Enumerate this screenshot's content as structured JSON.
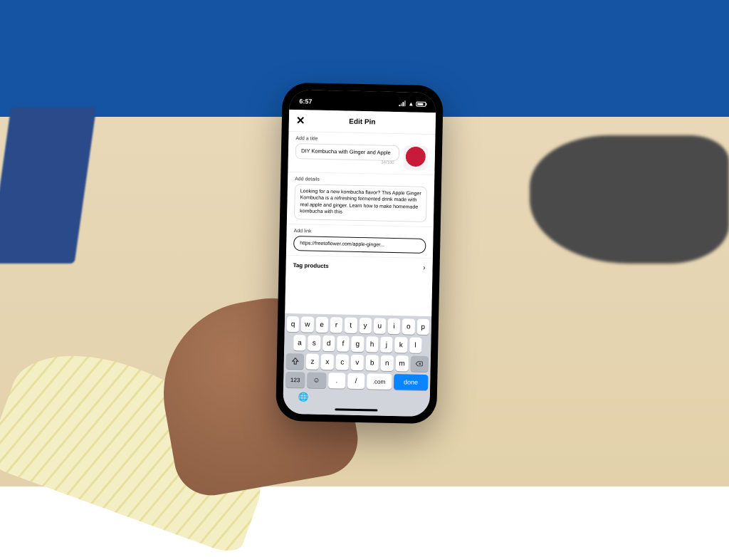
{
  "status": {
    "time": "6:57"
  },
  "header": {
    "title": "Edit Pin"
  },
  "title_section": {
    "label": "Add a title",
    "value": "DIY Kombucha with Ginger and Apple",
    "count": "34/100"
  },
  "details_section": {
    "label": "Add details",
    "value": "Looking for a new kombucha flavor? This Apple Ginger Kombucha is a refreshing fermented drink made with real apple and ginger. Learn how to make homemade kombucha with this"
  },
  "link_section": {
    "label": "Add link",
    "value": "https://freetoflower.com/apple-ginger..."
  },
  "tag_section": {
    "label": "Tag products"
  },
  "keyboard": {
    "row1": [
      "q",
      "w",
      "e",
      "r",
      "t",
      "y",
      "u",
      "i",
      "o",
      "p"
    ],
    "row2": [
      "a",
      "s",
      "d",
      "f",
      "g",
      "h",
      "j",
      "k",
      "l"
    ],
    "row3": [
      "z",
      "x",
      "c",
      "v",
      "b",
      "n",
      "m"
    ],
    "num": "123",
    "dot": ".",
    "slash": "/",
    "com": ".com",
    "done": "done"
  }
}
